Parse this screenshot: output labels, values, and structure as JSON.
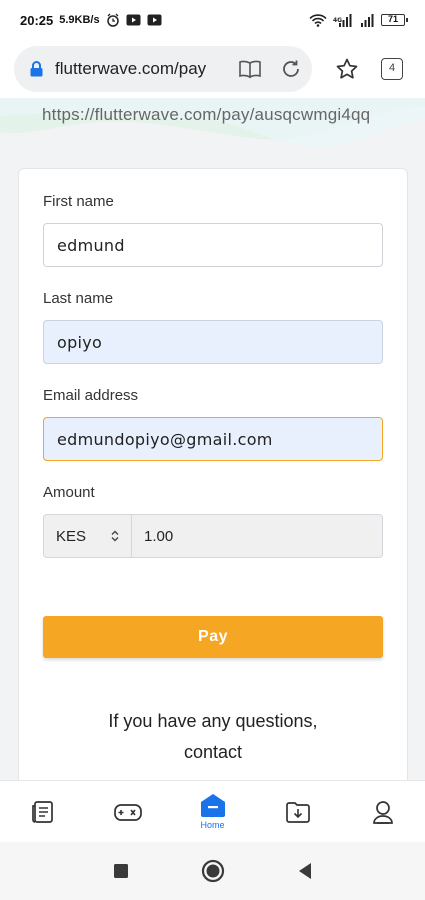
{
  "status_bar": {
    "time": "20:25",
    "speed": "5.9KB/s",
    "battery": "71"
  },
  "browser": {
    "url": "flutterwave.com/pay",
    "tab_count": "4"
  },
  "page": {
    "full_url": "https://flutterwave.com/pay/ausqcwmgi4qq",
    "form": {
      "first_name_label": "First name",
      "first_name_value": "edmund",
      "last_name_label": "Last name",
      "last_name_value": "opiyo",
      "email_label": "Email address",
      "email_value": "edmundopiyo@gmail.com",
      "amount_label": "Amount",
      "currency": "KES",
      "amount_value": "1.00",
      "pay_label": "Pay"
    },
    "help_line1": "If you have any questions,",
    "help_line2": "contact"
  },
  "bottom_nav": {
    "home_label": "Home"
  },
  "colors": {
    "accent": "#f5a623",
    "link_blue": "#1a73e8"
  }
}
